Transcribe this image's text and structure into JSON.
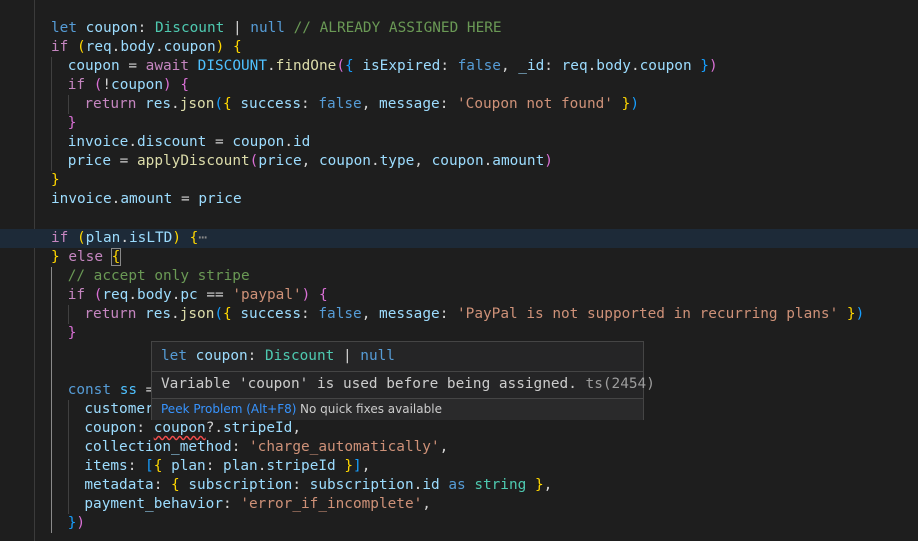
{
  "editor": {
    "lines": [
      {
        "indent": 0,
        "tokens": [
          [
            "kw",
            "let"
          ],
          [
            "p",
            " "
          ],
          [
            "var",
            "coupon"
          ],
          [
            "p",
            ": "
          ],
          [
            "type",
            "Discount"
          ],
          [
            "p",
            " | "
          ],
          [
            "kw",
            "null"
          ],
          [
            "p",
            " "
          ],
          [
            "cmt",
            "// ALREADY ASSIGNED HERE"
          ]
        ]
      },
      {
        "indent": 0,
        "tokens": [
          [
            "ctrl",
            "if"
          ],
          [
            "p",
            " "
          ],
          [
            "b1",
            "("
          ],
          [
            "var",
            "req"
          ],
          [
            "p",
            "."
          ],
          [
            "var",
            "body"
          ],
          [
            "p",
            "."
          ],
          [
            "var",
            "coupon"
          ],
          [
            "b1",
            ")"
          ],
          [
            "p",
            " "
          ],
          [
            "b1",
            "{"
          ]
        ]
      },
      {
        "indent": 1,
        "tokens": [
          [
            "var",
            "coupon"
          ],
          [
            "p",
            " = "
          ],
          [
            "ctrl",
            "await"
          ],
          [
            "p",
            " "
          ],
          [
            "const",
            "DISCOUNT"
          ],
          [
            "p",
            "."
          ],
          [
            "fn",
            "findOne"
          ],
          [
            "b2",
            "("
          ],
          [
            "b3",
            "{"
          ],
          [
            "p",
            " "
          ],
          [
            "var",
            "isExpired"
          ],
          [
            "p",
            ": "
          ],
          [
            "kw",
            "false"
          ],
          [
            "p",
            ", "
          ],
          [
            "var",
            "_id"
          ],
          [
            "p",
            ": "
          ],
          [
            "var",
            "req"
          ],
          [
            "p",
            "."
          ],
          [
            "var",
            "body"
          ],
          [
            "p",
            "."
          ],
          [
            "var",
            "coupon"
          ],
          [
            "p",
            " "
          ],
          [
            "b3",
            "}"
          ],
          [
            "b2",
            ")"
          ]
        ]
      },
      {
        "indent": 1,
        "tokens": [
          [
            "ctrl",
            "if"
          ],
          [
            "p",
            " "
          ],
          [
            "b2",
            "("
          ],
          [
            "p",
            "!"
          ],
          [
            "var",
            "coupon"
          ],
          [
            "b2",
            ")"
          ],
          [
            "p",
            " "
          ],
          [
            "b2",
            "{"
          ]
        ]
      },
      {
        "indent": 2,
        "tokens": [
          [
            "ctrl",
            "return"
          ],
          [
            "p",
            " "
          ],
          [
            "var",
            "res"
          ],
          [
            "p",
            "."
          ],
          [
            "fn",
            "json"
          ],
          [
            "b3",
            "("
          ],
          [
            "b1",
            "{"
          ],
          [
            "p",
            " "
          ],
          [
            "var",
            "success"
          ],
          [
            "p",
            ": "
          ],
          [
            "kw",
            "false"
          ],
          [
            "p",
            ", "
          ],
          [
            "var",
            "message"
          ],
          [
            "p",
            ": "
          ],
          [
            "str",
            "'Coupon not found'"
          ],
          [
            "p",
            " "
          ],
          [
            "b1",
            "}"
          ],
          [
            "b3",
            ")"
          ]
        ]
      },
      {
        "indent": 1,
        "tokens": [
          [
            "b2",
            "}"
          ]
        ]
      },
      {
        "indent": 1,
        "tokens": [
          [
            "var",
            "invoice"
          ],
          [
            "p",
            "."
          ],
          [
            "var",
            "discount"
          ],
          [
            "p",
            " = "
          ],
          [
            "var",
            "coupon"
          ],
          [
            "p",
            "."
          ],
          [
            "var",
            "id"
          ]
        ]
      },
      {
        "indent": 1,
        "tokens": [
          [
            "var",
            "price"
          ],
          [
            "p",
            " = "
          ],
          [
            "fn",
            "applyDiscount"
          ],
          [
            "b2",
            "("
          ],
          [
            "var",
            "price"
          ],
          [
            "p",
            ", "
          ],
          [
            "var",
            "coupon"
          ],
          [
            "p",
            "."
          ],
          [
            "var",
            "type"
          ],
          [
            "p",
            ", "
          ],
          [
            "var",
            "coupon"
          ],
          [
            "p",
            "."
          ],
          [
            "var",
            "amount"
          ],
          [
            "b2",
            ")"
          ]
        ]
      },
      {
        "indent": 0,
        "tokens": [
          [
            "b1",
            "}"
          ]
        ]
      },
      {
        "indent": 0,
        "tokens": [
          [
            "var",
            "invoice"
          ],
          [
            "p",
            "."
          ],
          [
            "var",
            "amount"
          ],
          [
            "p",
            " = "
          ],
          [
            "var",
            "price"
          ]
        ]
      },
      {
        "indent": 0,
        "tokens": []
      },
      {
        "indent": 0,
        "current": true,
        "tokens": [
          [
            "ctrl",
            "if"
          ],
          [
            "p",
            " "
          ],
          [
            "b1",
            "("
          ],
          [
            "var",
            "plan"
          ],
          [
            "p",
            "."
          ],
          [
            "var",
            "isLTD"
          ],
          [
            "b1",
            ")"
          ],
          [
            "p",
            " "
          ],
          [
            "b1",
            "{"
          ],
          [
            "fold",
            "⋯"
          ]
        ]
      },
      {
        "indent": 0,
        "tokens": [
          [
            "b1",
            "}"
          ],
          [
            "p",
            " "
          ],
          [
            "ctrl",
            "else"
          ],
          [
            "p",
            " "
          ],
          [
            "b1box",
            "{"
          ]
        ]
      },
      {
        "indent": 1,
        "active": true,
        "tokens": [
          [
            "cmt",
            "// accept only stripe"
          ]
        ]
      },
      {
        "indent": 1,
        "active": true,
        "tokens": [
          [
            "ctrl",
            "if"
          ],
          [
            "p",
            " "
          ],
          [
            "b2",
            "("
          ],
          [
            "var",
            "req"
          ],
          [
            "p",
            "."
          ],
          [
            "var",
            "body"
          ],
          [
            "p",
            "."
          ],
          [
            "var",
            "pc"
          ],
          [
            "p",
            " == "
          ],
          [
            "str",
            "'paypal'"
          ],
          [
            "b2",
            ")"
          ],
          [
            "p",
            " "
          ],
          [
            "b2",
            "{"
          ]
        ]
      },
      {
        "indent": 2,
        "active": true,
        "tokens": [
          [
            "ctrl",
            "return"
          ],
          [
            "p",
            " "
          ],
          [
            "var",
            "res"
          ],
          [
            "p",
            "."
          ],
          [
            "fn",
            "json"
          ],
          [
            "b3",
            "("
          ],
          [
            "b1",
            "{"
          ],
          [
            "p",
            " "
          ],
          [
            "var",
            "success"
          ],
          [
            "p",
            ": "
          ],
          [
            "kw",
            "false"
          ],
          [
            "p",
            ", "
          ],
          [
            "var",
            "message"
          ],
          [
            "p",
            ": "
          ],
          [
            "str",
            "'PayPal is not supported in recurring plans'"
          ],
          [
            "p",
            " "
          ],
          [
            "b1",
            "}"
          ],
          [
            "b3",
            ")"
          ]
        ]
      },
      {
        "indent": 1,
        "active": true,
        "tokens": [
          [
            "b2",
            "}"
          ]
        ]
      },
      {
        "indent": 1,
        "active": true,
        "tokens": []
      },
      {
        "indent": 1,
        "active": true,
        "tokens": []
      },
      {
        "indent": 1,
        "active": true,
        "tokens": [
          [
            "kw",
            "const"
          ],
          [
            "p",
            " "
          ],
          [
            "const",
            "ss"
          ],
          [
            "p",
            " ="
          ]
        ]
      },
      {
        "indent": 2,
        "active": true,
        "tokens": [
          [
            "var",
            "customer"
          ]
        ]
      },
      {
        "indent": 2,
        "active": true,
        "tokens": [
          [
            "var",
            "coupon"
          ],
          [
            "p",
            ": "
          ],
          [
            "varsq",
            "coupon"
          ],
          [
            "p",
            "?."
          ],
          [
            "var",
            "stripeId"
          ],
          [
            "p",
            ","
          ]
        ]
      },
      {
        "indent": 2,
        "active": true,
        "tokens": [
          [
            "var",
            "collection_method"
          ],
          [
            "p",
            ": "
          ],
          [
            "str",
            "'charge_automatically'"
          ],
          [
            "p",
            ","
          ]
        ]
      },
      {
        "indent": 2,
        "active": true,
        "tokens": [
          [
            "var",
            "items"
          ],
          [
            "p",
            ": "
          ],
          [
            "b3",
            "["
          ],
          [
            "b1",
            "{"
          ],
          [
            "p",
            " "
          ],
          [
            "var",
            "plan"
          ],
          [
            "p",
            ": "
          ],
          [
            "var",
            "plan"
          ],
          [
            "p",
            "."
          ],
          [
            "var",
            "stripeId"
          ],
          [
            "p",
            " "
          ],
          [
            "b1",
            "}"
          ],
          [
            "b3",
            "]"
          ],
          [
            "p",
            ","
          ]
        ]
      },
      {
        "indent": 2,
        "active": true,
        "tokens": [
          [
            "var",
            "metadata"
          ],
          [
            "p",
            ": "
          ],
          [
            "b1",
            "{"
          ],
          [
            "p",
            " "
          ],
          [
            "var",
            "subscription"
          ],
          [
            "p",
            ": "
          ],
          [
            "var",
            "subscription"
          ],
          [
            "p",
            "."
          ],
          [
            "var",
            "id"
          ],
          [
            "p",
            " "
          ],
          [
            "kw",
            "as"
          ],
          [
            "p",
            " "
          ],
          [
            "type",
            "string"
          ],
          [
            "p",
            " "
          ],
          [
            "b1",
            "}"
          ],
          [
            "p",
            ","
          ]
        ]
      },
      {
        "indent": 2,
        "active": true,
        "tokens": [
          [
            "var",
            "payment_behavior"
          ],
          [
            "p",
            ": "
          ],
          [
            "str",
            "'error_if_incomplete'"
          ],
          [
            "p",
            ","
          ]
        ]
      },
      {
        "indent": 1,
        "active": true,
        "tokens": [
          [
            "b3",
            "}"
          ],
          [
            "b2",
            ")"
          ]
        ]
      }
    ]
  },
  "hover": {
    "signature": [
      [
        "kw",
        "let"
      ],
      [
        "p",
        " "
      ],
      [
        "var",
        "coupon"
      ],
      [
        "p",
        ": "
      ],
      [
        "type",
        "Discount"
      ],
      [
        "p",
        " | "
      ],
      [
        "kw",
        "null"
      ]
    ],
    "diagnostic_message": "Variable 'coupon' is used before being assigned.",
    "diagnostic_code": "ts(2454)",
    "peek_label": "Peek Problem (Alt+F8)",
    "no_fix_label": "No quick fixes available"
  }
}
